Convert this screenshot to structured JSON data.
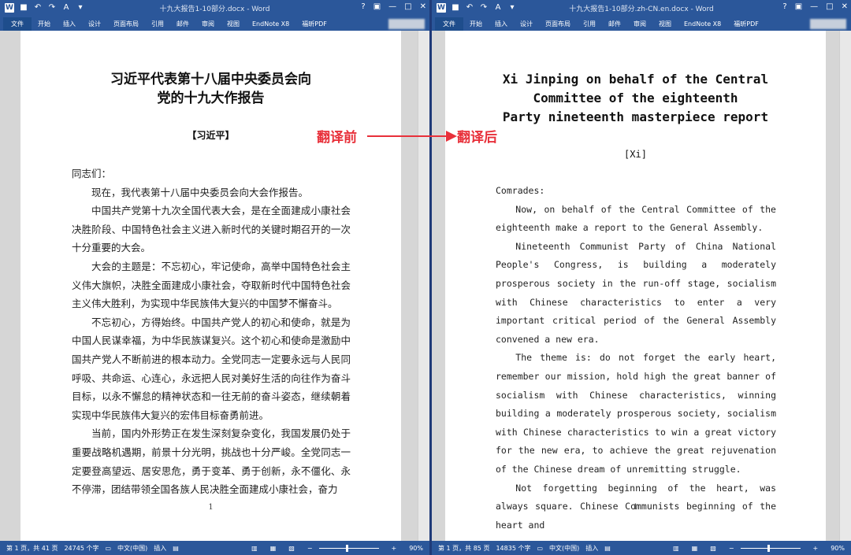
{
  "left_window": {
    "title": "十九大报告1-10部分.docx - Word",
    "tabs": [
      "文件",
      "开始",
      "插入",
      "设计",
      "页面布局",
      "引用",
      "邮件",
      "审阅",
      "视图",
      "EndNote X8",
      "福昕PDF"
    ],
    "status": {
      "page": "第 1 页，共 41 页",
      "words": "24745 个字",
      "lang": "中文(中国)",
      "mode": "插入",
      "zoom": "90%"
    },
    "doc": {
      "title_line1": "习近平代表第十八届中央委员会向",
      "title_line2": "党的十九大作报告",
      "author": "【习近平】",
      "paragraphs": [
        "同志们：",
        "现在，我代表第十八届中央委员会向大会作报告。",
        "中国共产党第十九次全国代表大会，是在全面建成小康社会决胜阶段、中国特色社会主义进入新时代的关键时期召开的一次十分重要的大会。",
        "大会的主题是：不忘初心，牢记使命，高举中国特色社会主义伟大旗帜，决胜全面建成小康社会，夺取新时代中国特色社会主义伟大胜利，为实现中华民族伟大复兴的中国梦不懈奋斗。",
        "不忘初心，方得始终。中国共产党人的初心和使命，就是为中国人民谋幸福，为中华民族谋复兴。这个初心和使命是激励中国共产党人不断前进的根本动力。全党同志一定要永远与人民同呼吸、共命运、心连心，永远把人民对美好生活的向往作为奋斗目标，以永不懈怠的精神状态和一往无前的奋斗姿态，继续朝着实现中华民族伟大复兴的宏伟目标奋勇前进。",
        "当前，国内外形势正在发生深刻复杂变化，我国发展仍处于重要战略机遇期，前景十分光明，挑战也十分严峻。全党同志一定要登高望远、居安思危，勇于变革、勇于创新，永不僵化、永不停滞，团结带领全国各族人民决胜全面建成小康社会，奋力"
      ],
      "page_number": "1"
    }
  },
  "right_window": {
    "title": "十九大报告1-10部分.zh-CN.en.docx - Word",
    "tabs": [
      "文件",
      "开始",
      "插入",
      "设计",
      "页面布局",
      "引用",
      "邮件",
      "审阅",
      "视图",
      "EndNote X8",
      "福昕PDF"
    ],
    "status": {
      "page": "第 1 页，共 85 页",
      "words": "14835 个字",
      "lang": "中文(中国)",
      "mode": "插入",
      "zoom": "90%"
    },
    "doc": {
      "title_line1": "Xi Jinping on behalf of the Central",
      "title_line2": "Committee of the eighteenth",
      "title_line3": "Party nineteenth masterpiece report",
      "author": "[Xi]",
      "paragraphs": [
        "Comrades:",
        "Now, on behalf of the Central Committee of the eighteenth make a report to the General Assembly.",
        "Nineteenth Communist Party of China National People's Congress, is building a moderately prosperous society in the run-off stage, socialism with Chinese characteristics to enter a very important critical period of the General Assembly convened a new era.",
        "The theme is: do not forget the early heart, remember our mission, hold high the great banner of socialism with Chinese characteristics, winning building a moderately prosperous society, socialism with Chinese characteristics to win a great victory for the new era, to achieve the great rejuvenation of the Chinese dream of unremitting struggle.",
        "Not forgetting beginning of the heart, was always square. Chinese Communists beginning of the heart and"
      ],
      "page_number": "1"
    }
  },
  "annotation": {
    "before": "翻译前",
    "after": "翻译后",
    "color": "#e8303a"
  },
  "colors": {
    "accent": "#2b579a"
  }
}
